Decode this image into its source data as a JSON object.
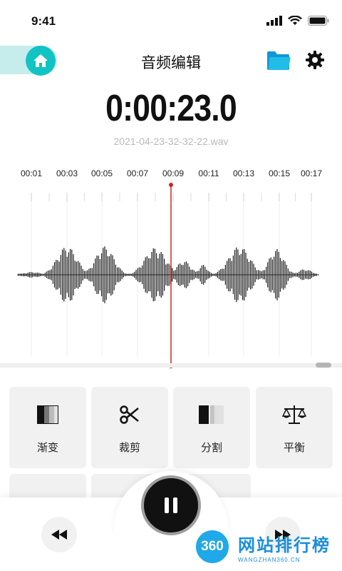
{
  "status_bar": {
    "time": "9:41",
    "icons": [
      "signal-icon",
      "wifi-icon",
      "battery-icon"
    ]
  },
  "header": {
    "title": "音频编辑",
    "accent_color": "#12c3c3",
    "home_icon": "home-icon",
    "folder_icon": "folder-icon",
    "settings_icon": "gear-icon"
  },
  "timer": {
    "elapsed": "0:00:23.0",
    "filename": "2021-04-23-32-32-22.wav"
  },
  "timeline": {
    "ticks": [
      "00:01",
      "00:03",
      "00:05",
      "00:07",
      "00:09",
      "00:11",
      "00:13",
      "00:15",
      "00:17"
    ],
    "playhead_color": "#c62828"
  },
  "tools": [
    {
      "label": "渐变",
      "icon": "fade-icon"
    },
    {
      "label": "裁剪",
      "icon": "scissors-icon"
    },
    {
      "label": "分割",
      "icon": "split-icon"
    },
    {
      "label": "平衡",
      "icon": "balance-icon"
    }
  ],
  "controls": {
    "play_icon": "pause-icon",
    "rewind_icon": "rewind-icon",
    "forward_icon": "fast-forward-icon"
  },
  "watermark": {
    "badge": "360",
    "name": "网站排行榜",
    "url": "WANGZHAN360.CN"
  }
}
